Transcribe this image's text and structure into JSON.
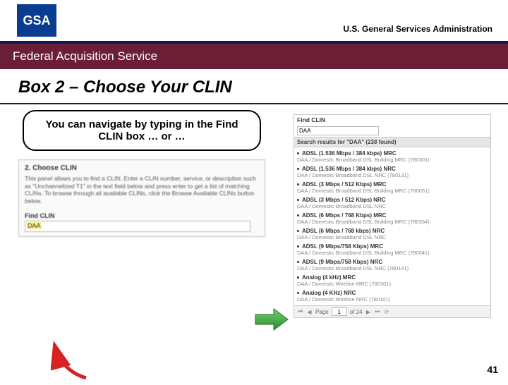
{
  "logo": "GSA",
  "header": "U.S. General Services Administration",
  "bar": "Federal Acquisition Service",
  "title": "Box 2 – Choose Your CLIN",
  "callout": "You can navigate by typing in the Find CLIN box … or …",
  "panel": {
    "heading": "2. Choose CLIN",
    "body": "This panel allows you to find a CLIN. Enter a CLIN number, service, or description such as \"Unchannelized T1\" in the text field below and press enter to get a list of matching CLINs. To browse through all available CLINs, click the Browse Available CLINs button below.",
    "findLabel": "Find CLIN",
    "findValue": "DAA"
  },
  "results": {
    "findLabel": "Find CLIN",
    "findValue": "DAA",
    "bar": "Search results for \"DAA\" (238 found)",
    "items": [
      {
        "n": "ADSL (1.536 Mbps / 384 kbps) MRC",
        "d": "DAA / Domestic Broadband DSL Building MRC (780301)"
      },
      {
        "n": "ADSL (1.536 Mbps / 384 kbps) NRC",
        "d": "DAA / Domestic Broadband DSL NRC (780131)"
      },
      {
        "n": "ADSL (3 Mbps / 512 Kbps) MRC",
        "d": "DAA / Domestic Broadband DSL Building MRC (780031)"
      },
      {
        "n": "ADSL (3 Mbps / 512 Kbps) NRC",
        "d": "DAA / Domestic Broadband DSL NRC"
      },
      {
        "n": "ADSL (6 Mbps / 768 Kbps) MRC",
        "d": "DAA / Domestic Broadband DSL Building MRC (780334)"
      },
      {
        "n": "ADSL (6 Mbps / 768 kbps) NRC",
        "d": "DAA / Domestic Broadband DSL NRC"
      },
      {
        "n": "ADSL (9 Mbps/758 Kbps) MRC",
        "d": "DAA / Domestic Broadband DSL Building MRC (780041)"
      },
      {
        "n": "ADSL (9 Mbps/758 Kbps) NRC",
        "d": "DAA / Domestic Broadband DSL NRC (780141)"
      },
      {
        "n": "Analog (4 kHz) MRC",
        "d": "DAA / Domestic Wireline MRC (780301)"
      },
      {
        "n": "Analog (4 KHz) NRC",
        "d": "DAA / Domestic Wireline NRC (780101)"
      }
    ],
    "pager": {
      "pageLabel": "Page",
      "page": "1",
      "ofLabel": "of 24"
    }
  },
  "pageNum": "41"
}
